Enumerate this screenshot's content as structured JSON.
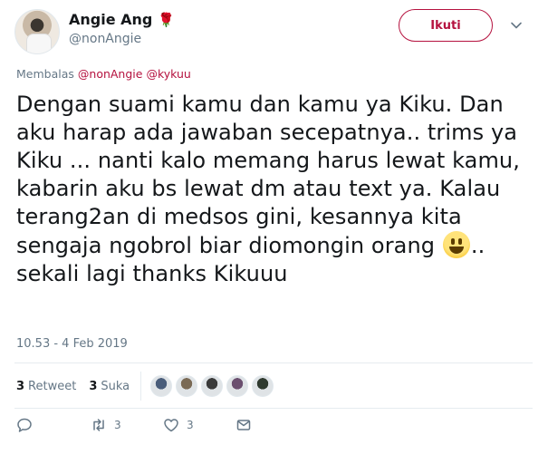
{
  "author": {
    "name": "Angie Ang",
    "name_suffix_icon": "rose-emoji",
    "handle": "@nonAngie",
    "avatar_icon": "profile-photo"
  },
  "header": {
    "follow_label": "Ikuti",
    "more_icon": "chevron-down-icon"
  },
  "reply": {
    "prefix": "Membalas",
    "mentions": [
      "@nonAngie",
      "@kykuu"
    ]
  },
  "tweet": {
    "text_before_emoji": "Dengan suami kamu dan kamu ya Kiku. Dan aku harap ada jawaban secepatnya.. trims ya Kiku ... nanti kalo memang harus lewat kamu, kabarin aku bs lewat dm atau text ya. Kalau terang2an di medsos gini, kesannya kita sengaja ngobrol biar diomongin orang",
    "emoji": "grinning-face-emoji",
    "text_after_emoji": ".. sekali lagi thanks Kikuuu"
  },
  "timestamp": "10.53 - 4 Feb 2019",
  "stats": {
    "retweets_count": "3",
    "retweets_label": "Retweet",
    "likes_count": "3",
    "likes_label": "Suka",
    "liker_avatar_colors": [
      "#4a5d7a",
      "#7a6a55",
      "#3a3a3a",
      "#6b4f6f",
      "#2f3a2f"
    ]
  },
  "actions": {
    "reply_icon": "reply-icon",
    "retweet_icon": "retweet-icon",
    "retweet_count": "3",
    "like_icon": "heart-icon",
    "like_count": "3",
    "message_icon": "envelope-icon"
  },
  "colors": {
    "accent": "#b5123f",
    "secondary_text": "#657786",
    "primary_text": "#14171a"
  }
}
